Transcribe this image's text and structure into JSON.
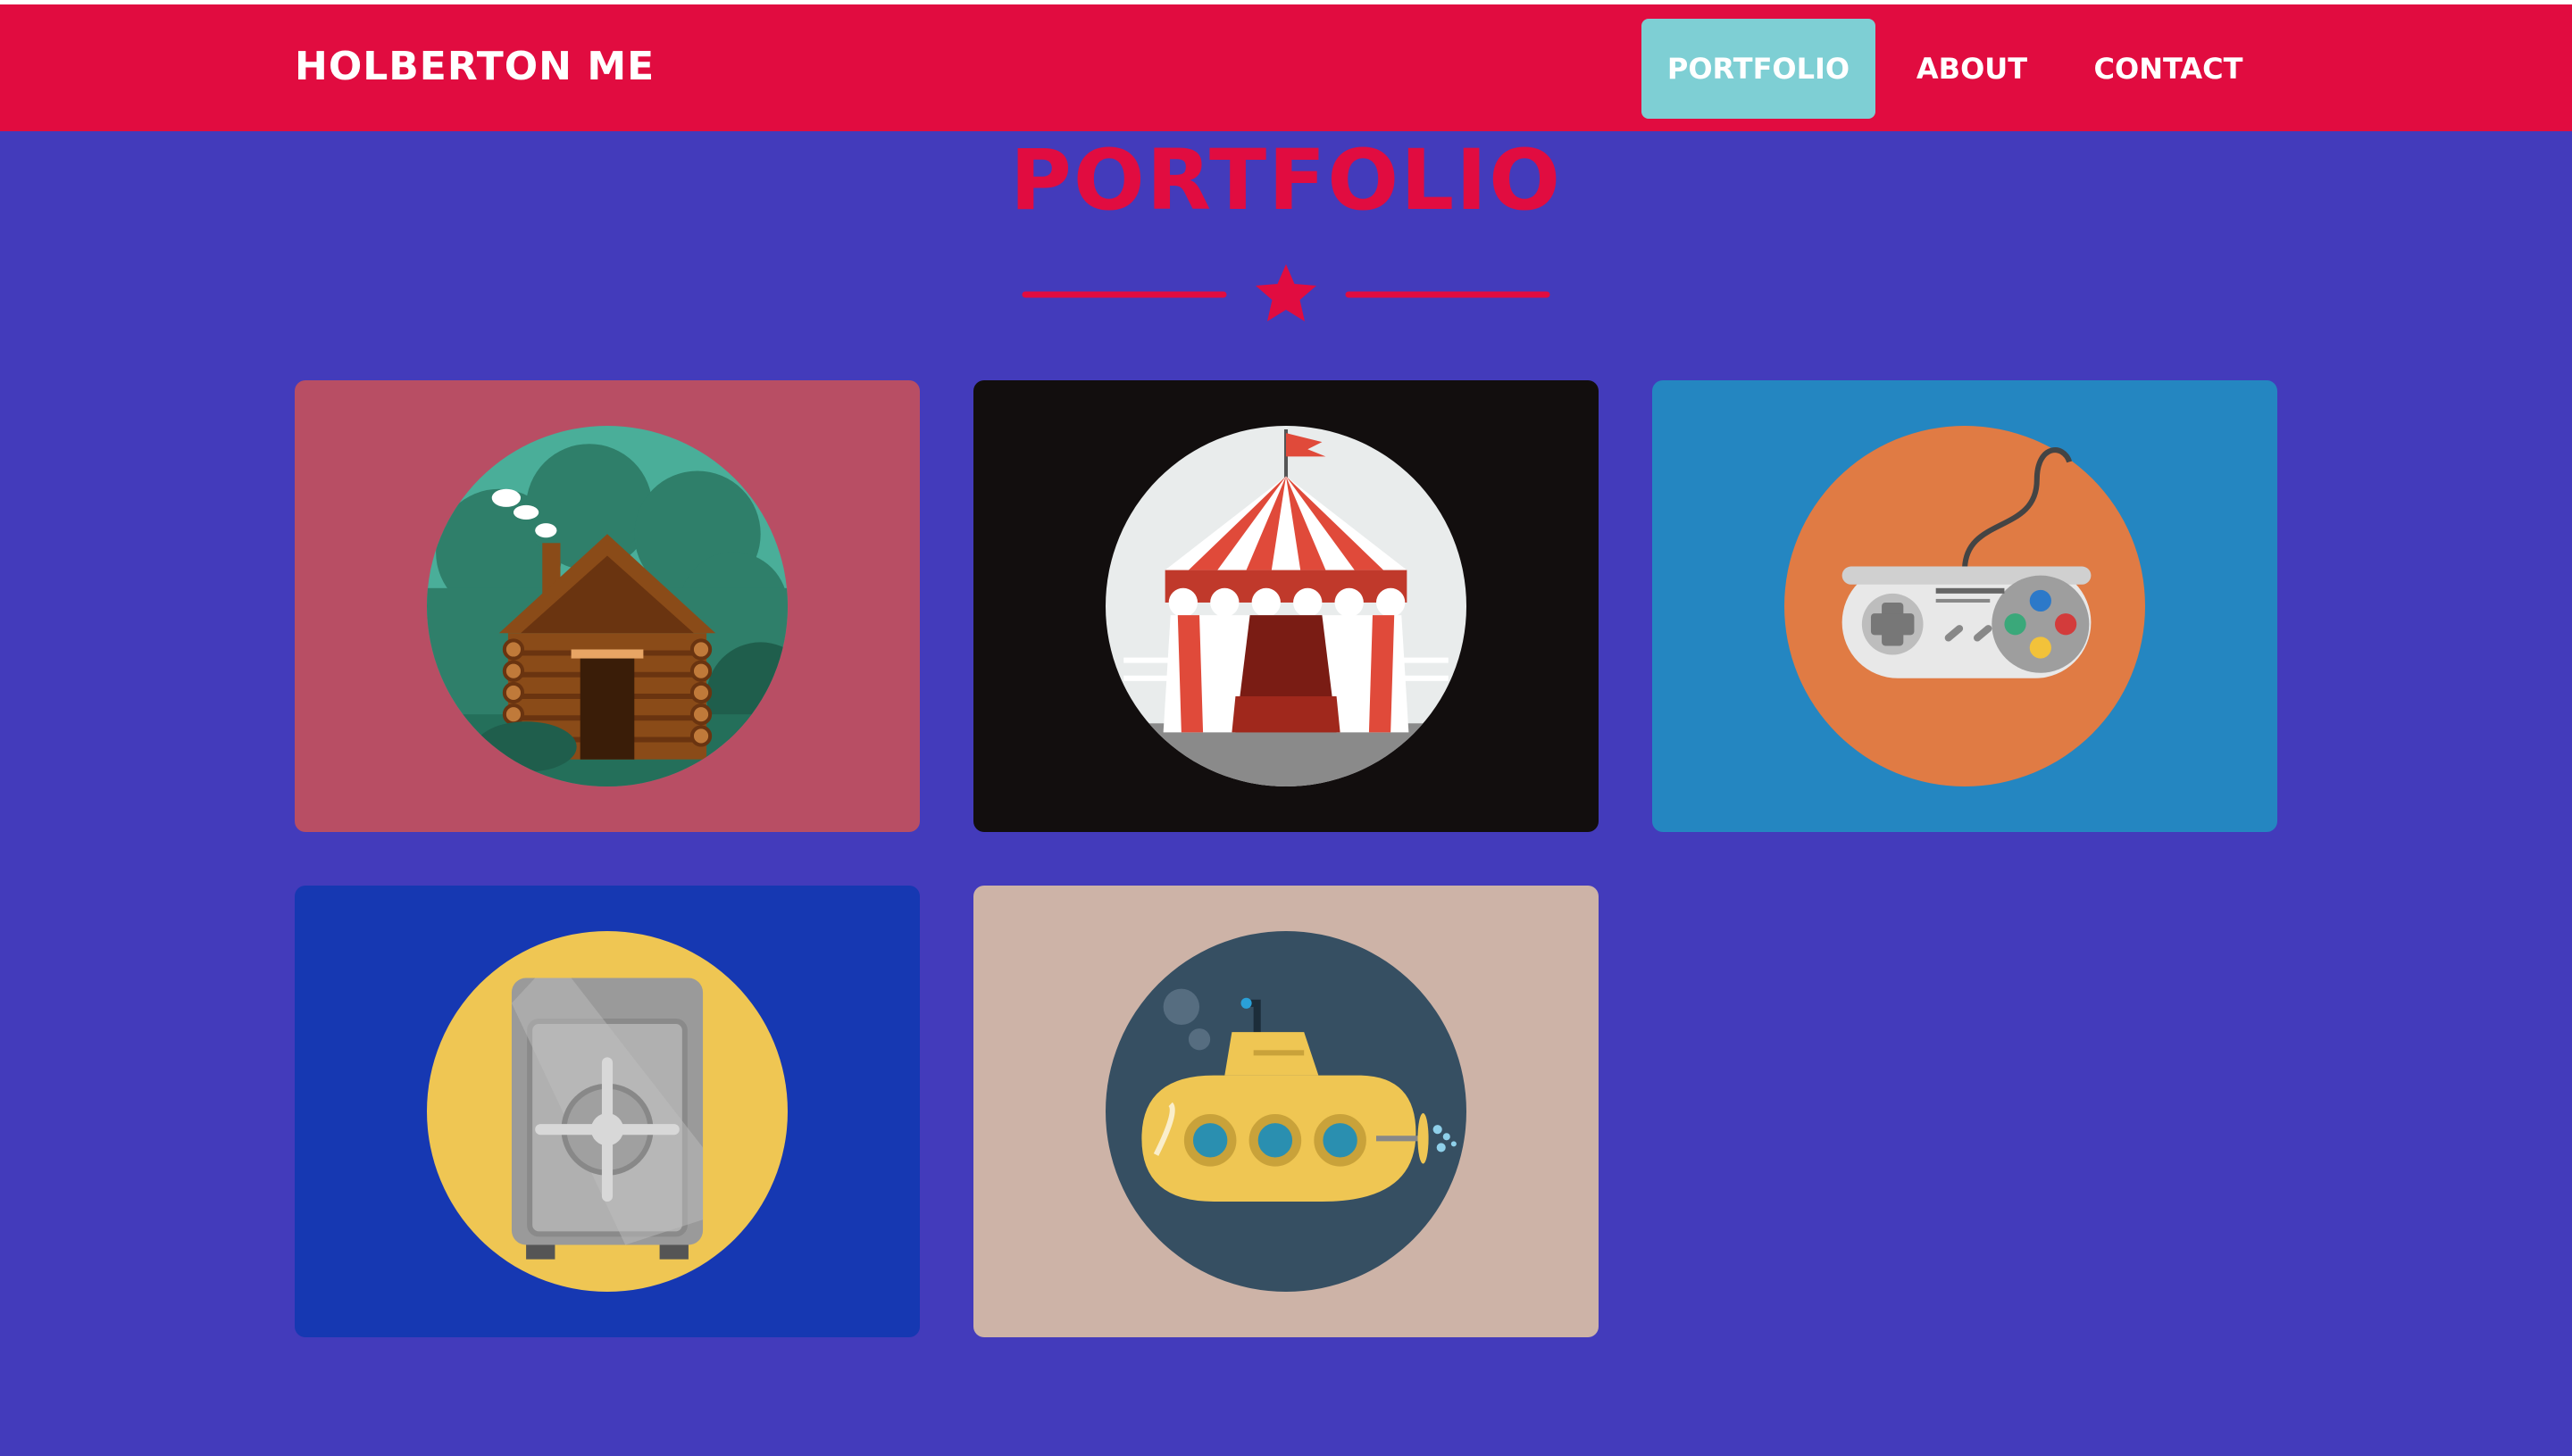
{
  "navbar": {
    "brand": "HOLBERTON ME",
    "items": [
      {
        "label": "PORTFOLIO",
        "active": true
      },
      {
        "label": "ABOUT",
        "active": false
      },
      {
        "label": "CONTACT",
        "active": false
      }
    ]
  },
  "portfolio": {
    "title": "PORTFOLIO",
    "divider_icon": "star-icon",
    "cards": [
      {
        "icon": "log-cabin-icon",
        "bg_color": "#b84e64",
        "circle_color": "#4aae99"
      },
      {
        "icon": "circus-tent-icon",
        "bg_color": "#120e0e",
        "circle_color": "#e9ecec"
      },
      {
        "icon": "game-controller-icon",
        "bg_color": "#2486c1",
        "circle_color": "#e07b44"
      },
      {
        "icon": "safe-icon",
        "bg_color": "#1638b2",
        "circle_color": "#efc653"
      },
      {
        "icon": "submarine-icon",
        "bg_color": "#cdb3a7",
        "circle_color": "#364f62"
      }
    ]
  },
  "colors": {
    "page_bg": "#433bbb",
    "navbar_bg": "#e10c40",
    "nav_active_bg": "#7ecfd4",
    "accent": "#e10c40"
  }
}
